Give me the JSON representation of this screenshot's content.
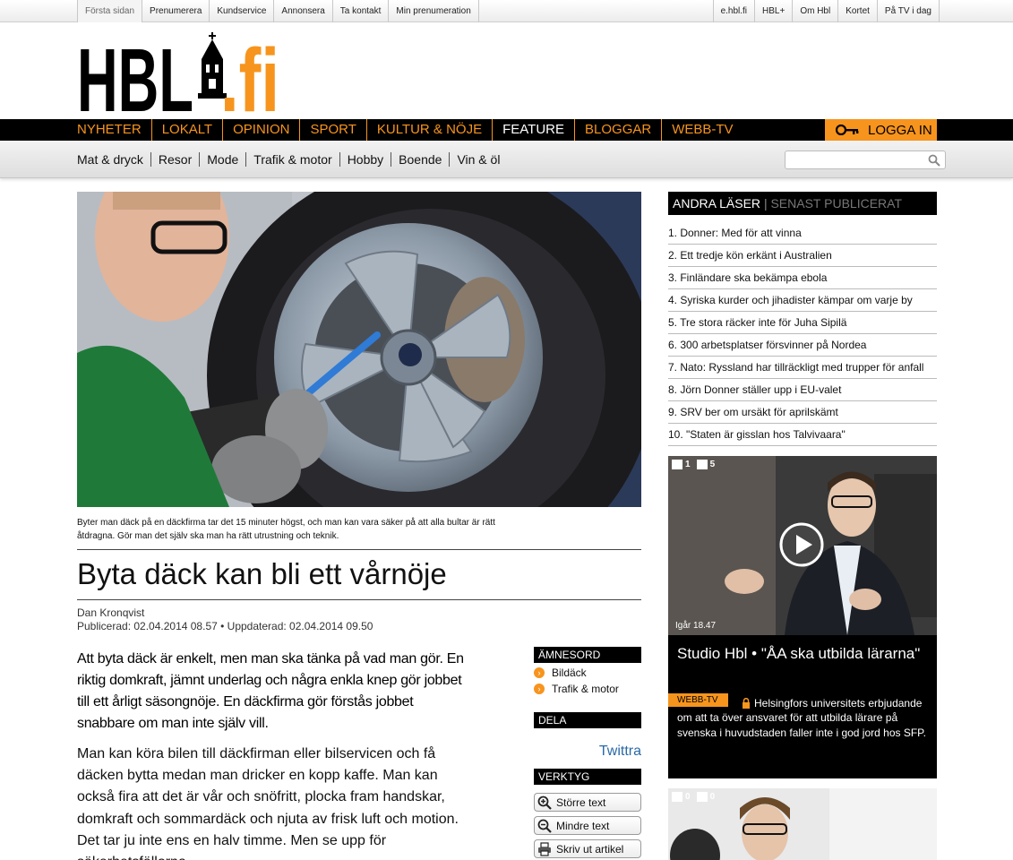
{
  "topbar": {
    "left_links": [
      "Första sidan",
      "Prenumerera",
      "Kundservice",
      "Annonsera",
      "Ta kontakt",
      "Min prenumeration"
    ],
    "right_links": [
      "e.hbl.fi",
      "HBL+",
      "Om Hbl",
      "Kortet",
      "På TV i dag"
    ]
  },
  "logo": {
    "text": "HBL",
    "suffix": ".fi",
    "accent": "#f7941d"
  },
  "mainnav": {
    "items": [
      "NYHETER",
      "LOKALT",
      "OPINION",
      "SPORT",
      "KULTUR & NÖJE",
      "FEATURE",
      "BLOGGAR",
      "WEBB-TV"
    ],
    "active": "FEATURE",
    "login_label": "LOGGA IN"
  },
  "subnav": {
    "items": [
      "Mat & dryck",
      "Resor",
      "Mode",
      "Trafik & motor",
      "Hobby",
      "Boende",
      "Vin & öl"
    ],
    "search_placeholder": ""
  },
  "article": {
    "caption": "Byter man däck på en däckfirma tar det 15 minuter högst, och man kan vara säker på att alla bultar är rätt åtdragna. Gör man det själv ska man ha rätt utrustning och teknik.",
    "title": "Byta däck kan bli ett vårnöje",
    "author": "Dan Kronqvist",
    "published": "Publicerad: 02.04.2014 08.57 • Uppdaterad: 02.04.2014 09.50",
    "lead": "Att byta däck är enkelt, men man ska tänka på vad man gör. En riktig domkraft, jämnt underlag och några enkla knep gör jobbet till ett årligt säsongnöje. En däckfirma gör förstås jobbet snabbare om man inte själv vill.",
    "body": "Man kan köra bilen till däckfirman eller bilservicen och få däcken bytta medan man dricker en kopp kaffe. Man kan också fira att det är vår och snöfritt, plocka fram handskar, domkraft och sommardäck och njuta av frisk luft och motion. Det tar ju inte ens en halv timme. Men se upp för säkerhetsfällorna."
  },
  "sidebar": {
    "amnesord_label": "ÄMNESORD",
    "tags": [
      "Bildäck",
      "Trafik & motor"
    ],
    "dela_label": "DELA",
    "twitter_label": "Twittra",
    "verktyg_label": "VERKTYG",
    "tools": [
      "Större text",
      "Mindre text",
      "Skriv ut artikel"
    ]
  },
  "right": {
    "tab_active": "ANDRA LÄSER",
    "tab_inactive": "SENAST PUBLICERAT",
    "list": [
      "1. Donner: Med för att vinna",
      "2. Ett tredje kön erkänt i Australien",
      "3. Finländare ska bekämpa ebola",
      "4. Syriska kurder och jihadister kämpar om varje by",
      "5. Tre stora räcker inte för Juha Sipilä",
      "6. 300 arbetsplatser försvinner på Nordea",
      "7. Nato: Ryssland har tillräckligt med trupper för anfall",
      "8. Jörn Donner ställer upp i EU-valet",
      "9. SRV ber om ursäkt för aprilskämt",
      "10. \"Staten är gisslan hos Talvivaara\""
    ],
    "video": {
      "comments": "1",
      "likes": "5",
      "time": "Igår 18.47",
      "title": "Studio Hbl • \"ÅA ska utbilda lärarna\"",
      "badge": "WEBB-TV",
      "desc": "Helsingfors universitets erbjudande om att ta över ansvaret för att utbilda lärare på svenska i huvudstaden faller inte i god jord hos SFP."
    },
    "card2": {
      "comments": "0",
      "likes": "0"
    }
  }
}
